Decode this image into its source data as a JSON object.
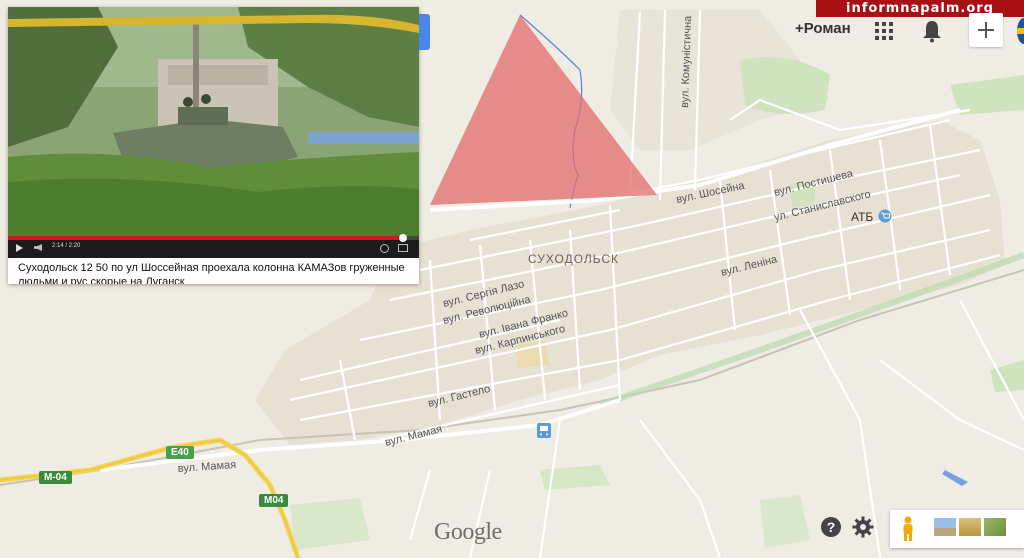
{
  "brand": {
    "text": "informnapalm.org"
  },
  "user": {
    "name": "+Роман"
  },
  "map": {
    "town_label": "СУХОДОЛЬСК",
    "poi": {
      "name": "АТБ"
    },
    "streets": {
      "komunistychna": "вул. Комуністична",
      "shoseina": "вул. Шосейна",
      "postysheva": "вул. Постишева",
      "stanislavskoho": "ул. Станиславского",
      "lenina": "вул. Леніна",
      "serhiia_lazo": "вул. Сергія Лазо",
      "revoliutsiina": "вул. Революційна",
      "ivana_franko": "вул. Івана Франко",
      "karpinskoho": "вул. Карпинського",
      "hastelo": "вул. Гастело",
      "mamaia_1": "вул. Мамая",
      "mamaia_2": "вул. Мамая"
    },
    "road_badges": {
      "e40": "E40",
      "m04_left": "M-04",
      "m04_bottom": "M04"
    },
    "attribution": "Google"
  },
  "video": {
    "caption": "Суходольск 12 50 по ул Шоссейная проехала колонна КАМАЗов груженные людьми и рус скорые на Луганск",
    "time": "2:14 / 2:20",
    "progress": 0.96
  },
  "colors": {
    "map_bg": "#efece4",
    "urban": "#e6e0d3",
    "marker_triangle": "#e26b6b",
    "river": "#5a7fd6",
    "brand_red": "#a81016",
    "road_yellow": "#f4d34f"
  },
  "icons": {
    "apps": "grid-icon",
    "notifications": "bell-icon",
    "add": "plus-icon",
    "help": "question-icon",
    "settings": "gear-icon",
    "pegman": "pegman-icon",
    "bus_stop": "bus-icon",
    "shop": "cart-icon"
  }
}
